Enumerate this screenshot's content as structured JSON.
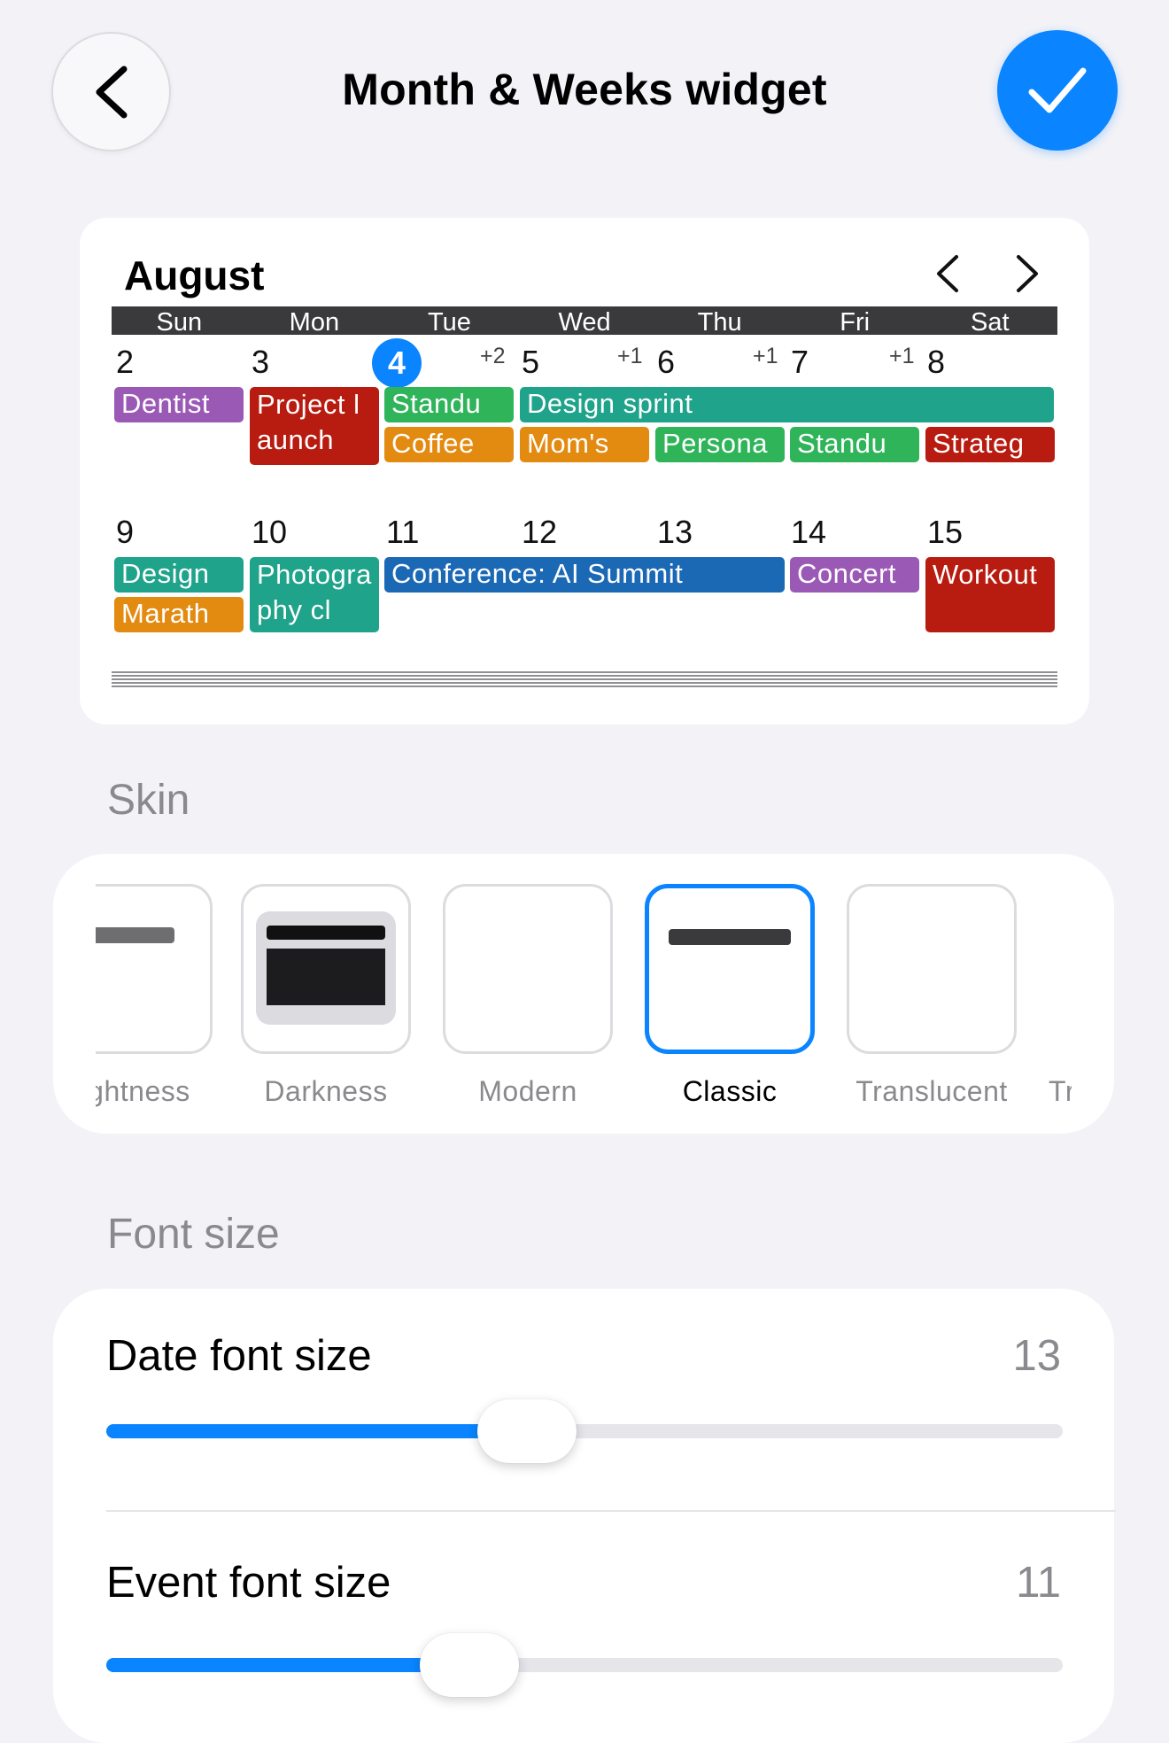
{
  "header": {
    "title": "Month & Weeks widget",
    "back_icon": "chevron-left-icon",
    "done_icon": "checkmark-icon"
  },
  "colors": {
    "accent": "#0a84ff",
    "purple": "#9b59b6",
    "red": "#b81b10",
    "green": "#2fb45a",
    "teal": "#1fa38a",
    "orange": "#e38a10",
    "blue": "#1b68b5"
  },
  "preview": {
    "month": "August",
    "weekdays": [
      "Sun",
      "Mon",
      "Tue",
      "Wed",
      "Thu",
      "Fri",
      "Sat"
    ],
    "week1": {
      "days": [
        "2",
        "3",
        "4",
        "5",
        "6",
        "7",
        "8"
      ],
      "more": [
        "+2",
        "+1",
        "+1",
        "+1"
      ],
      "events": {
        "dentist": "Dentist",
        "project_launch": "Project launch",
        "standup_tue": "Standu",
        "design_sprint": "Design sprint",
        "coffee": "Coffee",
        "moms": "Mom's",
        "persona": "Persona",
        "standup_fri": "Standu",
        "strategy": "Strateg"
      }
    },
    "week2": {
      "days": [
        "9",
        "10",
        "11",
        "12",
        "13",
        "14",
        "15"
      ],
      "events": {
        "design": "Design",
        "marathon": "Marath",
        "photography": "Photography cl",
        "conference": "Conference: AI Summit",
        "concert": "Concert",
        "workout": "Workout"
      }
    }
  },
  "skin": {
    "label": "Skin",
    "options": [
      "Lightness",
      "Darkness",
      "Modern",
      "Classic",
      "Translucent",
      "Tr"
    ],
    "selected": "Classic"
  },
  "font_size": {
    "label": "Font size",
    "date": {
      "label": "Date font size",
      "value": "13",
      "fraction": 0.44
    },
    "event": {
      "label": "Event font size",
      "value": "11",
      "fraction": 0.38
    }
  }
}
